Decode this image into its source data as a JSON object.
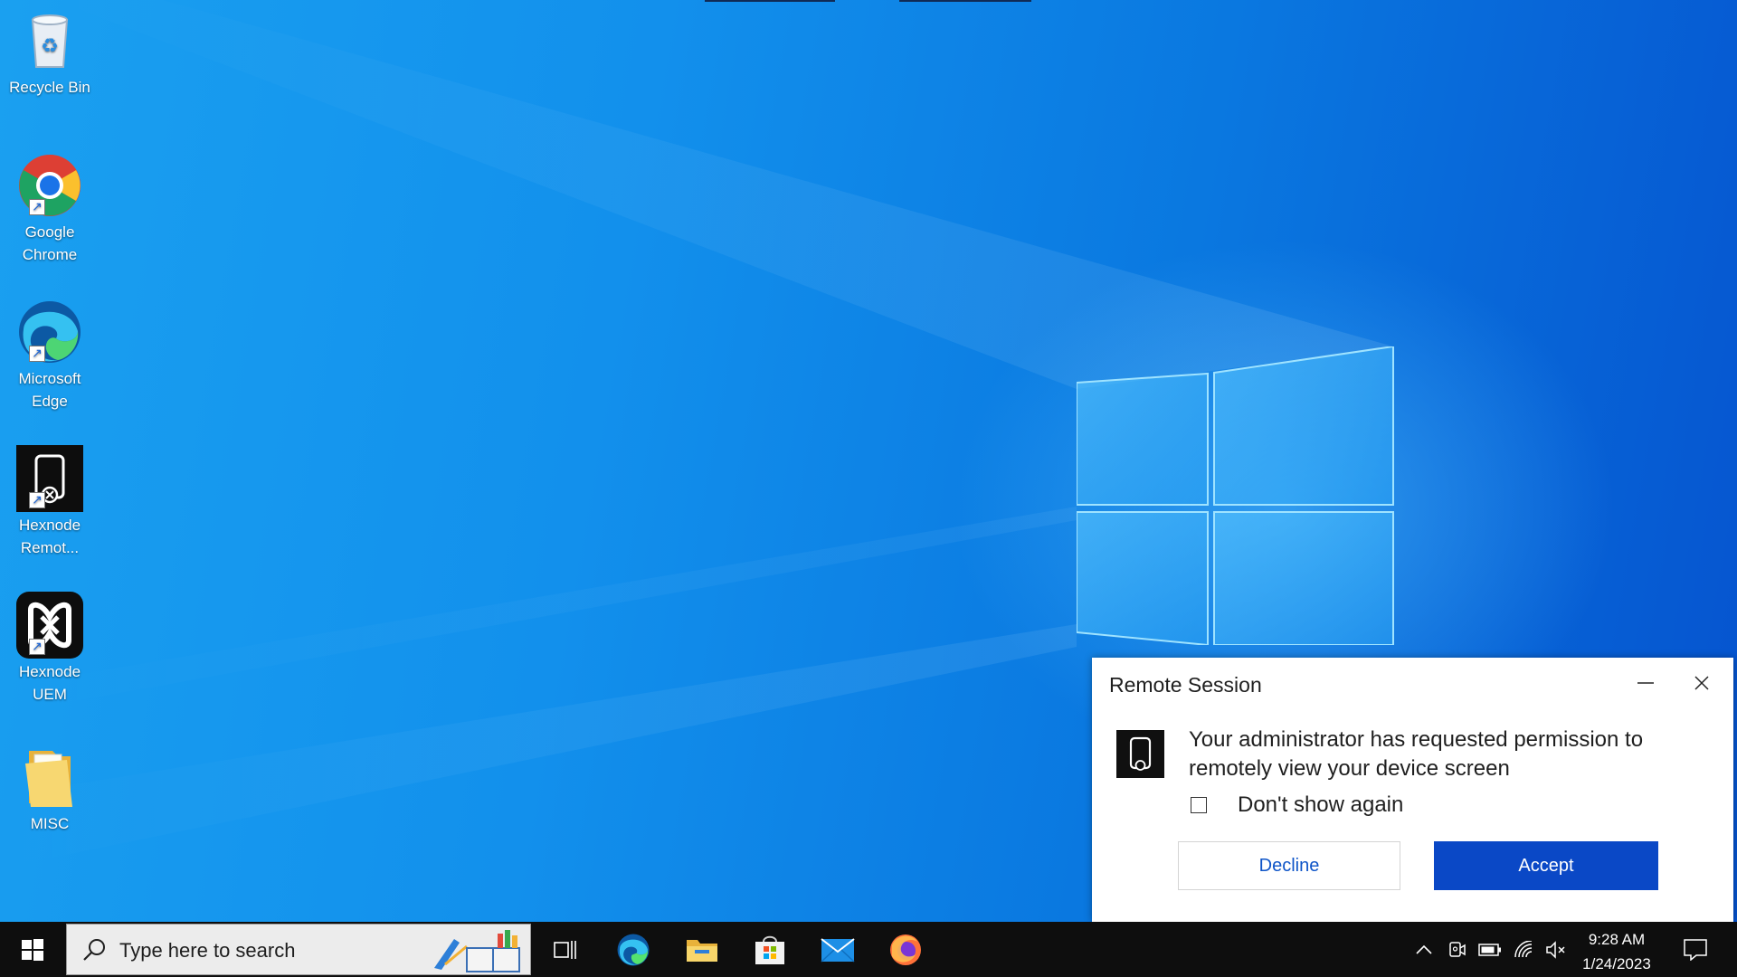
{
  "desktop_icons": [
    {
      "name": "recycle-bin",
      "label": "Recycle Bin"
    },
    {
      "name": "google-chrome",
      "label": "Google Chrome"
    },
    {
      "name": "microsoft-edge",
      "label": "Microsoft Edge"
    },
    {
      "name": "hexnode-remote",
      "label": "Hexnode Remot..."
    },
    {
      "name": "hexnode-uem",
      "label": "Hexnode UEM"
    },
    {
      "name": "misc-folder",
      "label": "MISC"
    }
  ],
  "dialog": {
    "title": "Remote Session",
    "message": "Your administrator has requested permission to remotely view your device screen",
    "checkbox_label": "Don't show again",
    "checkbox_checked": false,
    "decline_label": "Decline",
    "accept_label": "Accept",
    "accent_color": "#0a48c6"
  },
  "taskbar": {
    "search_placeholder": "Type here to search",
    "pinned": [
      "task-view-icon",
      "edge-icon",
      "file-explorer-icon",
      "microsoft-store-icon",
      "mail-icon",
      "firefox-icon"
    ],
    "tray_icons": [
      "chevron-up-icon",
      "meet-now-icon",
      "battery-icon",
      "wifi-icon",
      "volume-muted-icon"
    ],
    "time": "9:28 AM",
    "date": "1/24/2023"
  }
}
